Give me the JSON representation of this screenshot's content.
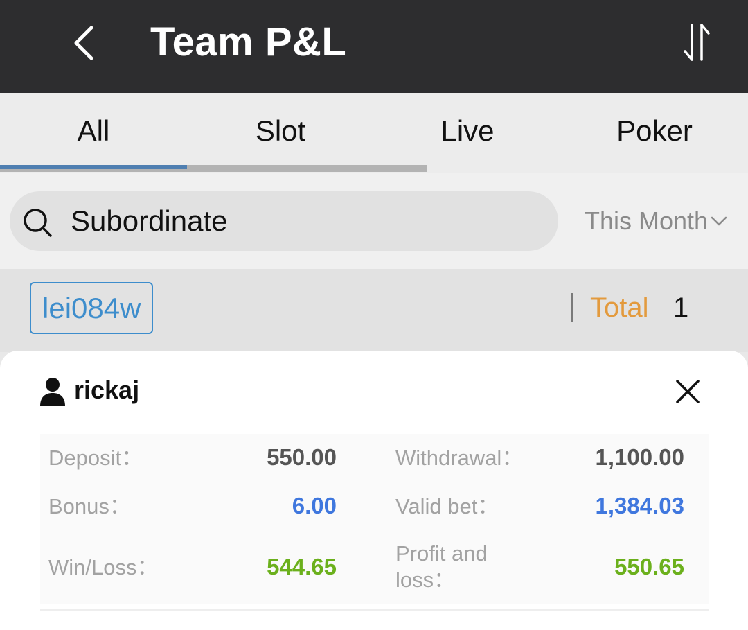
{
  "header": {
    "title": "Team P&L",
    "back_icon": "chevron-left-icon",
    "sort_icon": "sort-arrows-icon"
  },
  "tabs": [
    {
      "label": "All",
      "active": true
    },
    {
      "label": "Slot",
      "active": false
    },
    {
      "label": "Live",
      "active": false
    },
    {
      "label": "Poker",
      "active": false
    }
  ],
  "search": {
    "value": "Subordinate",
    "icon": "search-icon"
  },
  "period": {
    "selected": "This Month",
    "icon": "chevron-down-icon"
  },
  "level": {
    "account": "lei084w",
    "total_label": "Total",
    "total_value": "1"
  },
  "record": {
    "user": "rickaj",
    "user_icon": "user-icon",
    "close_icon": "close-icon",
    "stats": {
      "deposit_label": "Deposit：",
      "deposit_value": "550.00",
      "withdrawal_label": "Withdrawal：",
      "withdrawal_value": "1,100.00",
      "bonus_label": "Bonus：",
      "bonus_value": "6.00",
      "valid_bet_label": "Valid bet：",
      "valid_bet_value": "1,384.03",
      "winloss_label": "Win/Loss：",
      "winloss_value": "544.65",
      "pl_label_line1": "Profit and",
      "pl_label_line2": "loss：",
      "pl_value": "550.65"
    }
  },
  "colors": {
    "header_bg": "#2d2d2f",
    "tab_indicator": "#4f7fb1",
    "account_blue": "#3d8dcc",
    "total_orange": "#e39a3d",
    "value_blue": "#3f77de",
    "value_green": "#6bb01c"
  }
}
